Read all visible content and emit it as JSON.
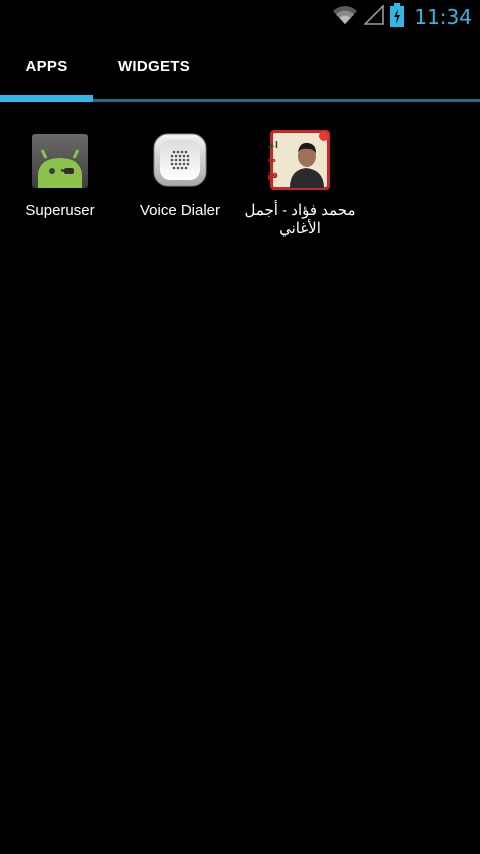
{
  "status_bar": {
    "time": "11:34",
    "icons": [
      "wifi-icon",
      "signal-icon",
      "battery-charging-icon"
    ],
    "accent_color": "#33b5e5"
  },
  "tabs": [
    {
      "label": "APPS",
      "selected": true
    },
    {
      "label": "WIDGETS",
      "selected": false
    }
  ],
  "apps": [
    {
      "label": "Superuser",
      "icon": "superuser-android-icon"
    },
    {
      "label": "Voice Dialer",
      "icon": "voice-dialer-grille-icon"
    },
    {
      "label": "محمد فؤاد - أجمل الأغاني",
      "icon": "mohamed-fouad-album-icon",
      "icon_text": "اغاني محمد فؤاد"
    }
  ]
}
